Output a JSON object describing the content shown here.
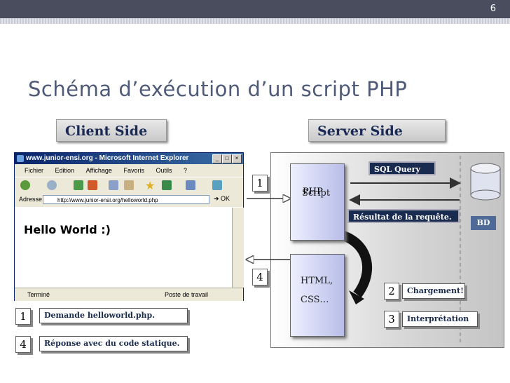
{
  "slide_number": "6",
  "title": "Schéma d’exécution d’un script PHP",
  "client_side": "Client Side",
  "server_side": "Server Side",
  "browser": {
    "title": "www.junior-ensi.org - Microsoft Internet Explorer",
    "menu": [
      "Fichier",
      "Edition",
      "Affichage",
      "Favoris",
      "Outils",
      "?"
    ],
    "address_label": "Adresse",
    "url": "http://www.junior-ensi.org/helloworld.php",
    "go": "OK",
    "content": "Hello World :)",
    "status_left": "Terminé",
    "status_right": "Poste de travail"
  },
  "server": {
    "script_line1": "Script",
    "script_line2": "PHP",
    "html_line1": "HTML,",
    "html_line2": "CSS…",
    "sql_query": "SQL Query",
    "resultat": "Résultat de la requête.",
    "bd": "BD",
    "step2_num": "2",
    "step2_label": "Chargement!",
    "step3_num": "3",
    "step3_label": "Interprétation",
    "step1_num": "1",
    "step4_num": "4"
  },
  "legend": {
    "step1_num": "1",
    "step1_label": "Demande helloworld.php.",
    "step4_num": "4",
    "step4_label": "Réponse avec du code statique."
  }
}
